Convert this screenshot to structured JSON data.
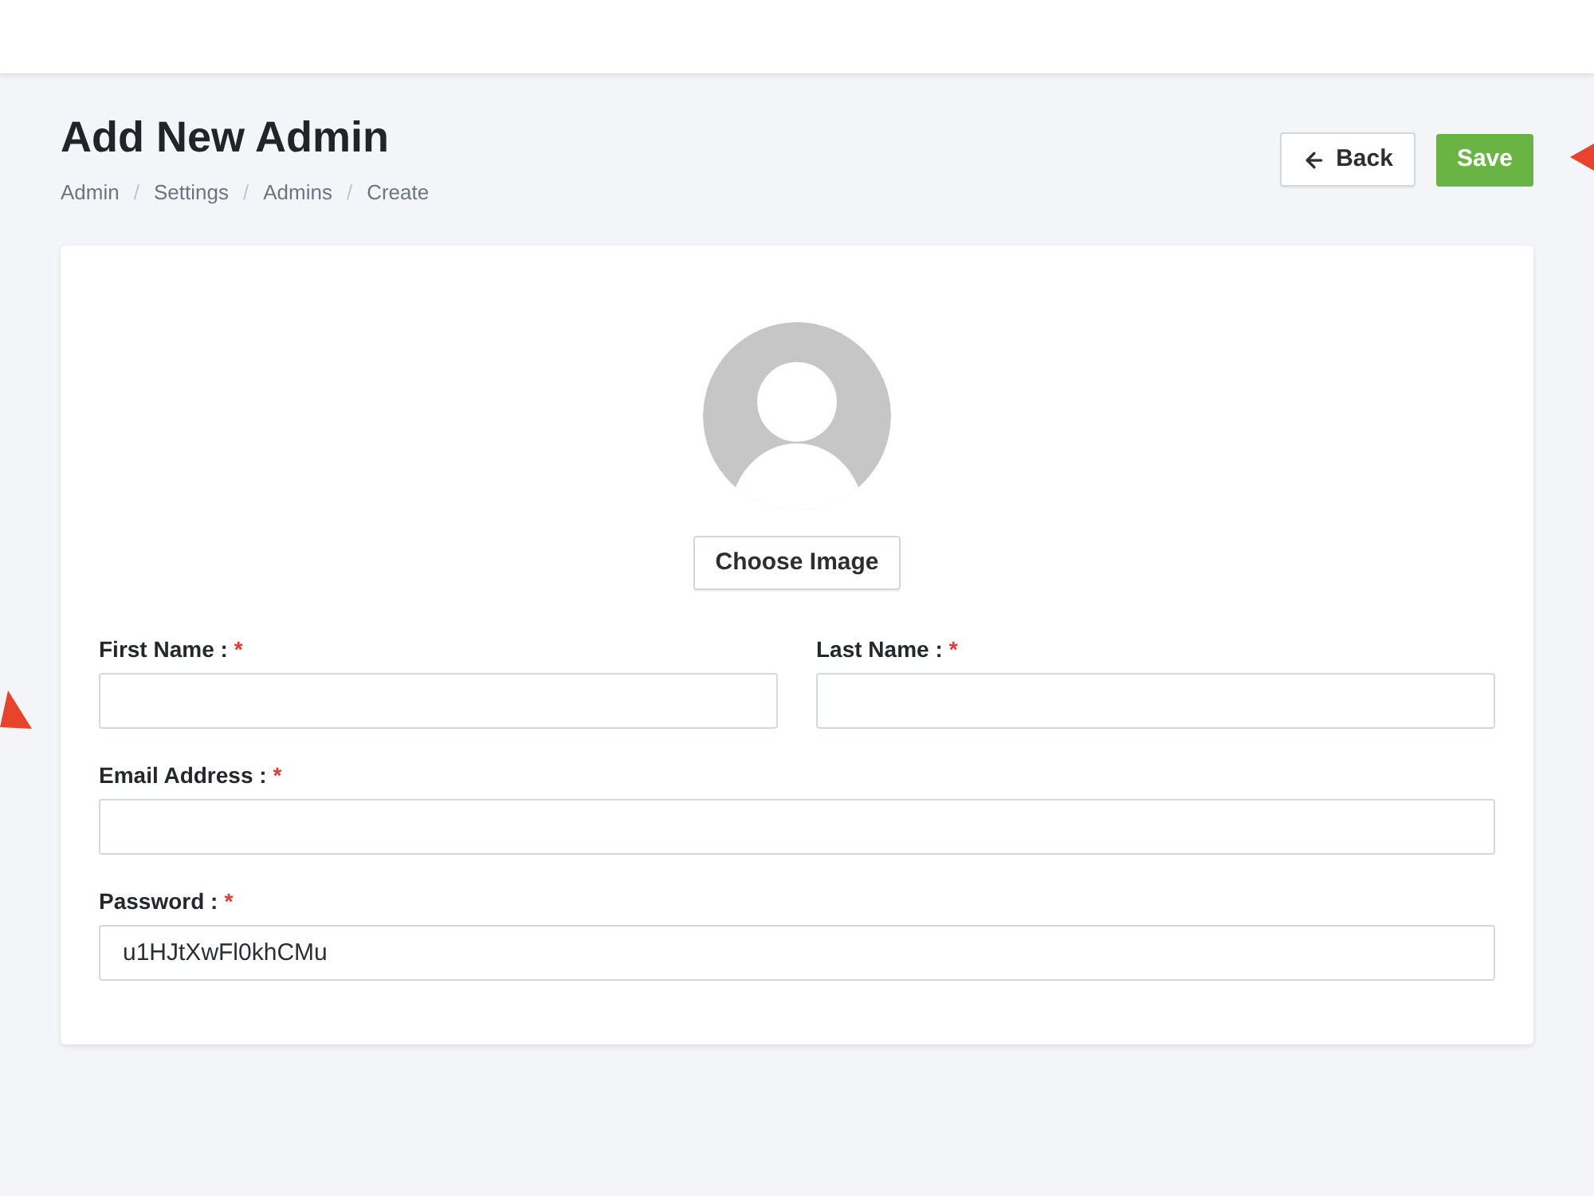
{
  "header": {
    "title": "Add New Admin",
    "breadcrumb": [
      {
        "kind": "link",
        "text": "Admin"
      },
      {
        "kind": "separator",
        "text": "/"
      },
      {
        "kind": "link",
        "text": "Settings"
      },
      {
        "kind": "separator",
        "text": "/"
      },
      {
        "kind": "link",
        "text": "Admins"
      },
      {
        "kind": "separator",
        "text": "/"
      },
      {
        "kind": "current",
        "text": "Create"
      }
    ],
    "actions": [
      {
        "kind": "back",
        "label": "Back"
      },
      {
        "kind": "primary",
        "label": "Save"
      }
    ]
  },
  "form": {
    "choose_image_button": "Choose Image",
    "rows": [
      [
        {
          "label": "First Name :",
          "required_mark": "*"
        },
        {
          "label": "Last Name :",
          "required_mark": "*"
        }
      ],
      [
        {
          "label": "Email Address :",
          "required_mark": "*"
        }
      ],
      [
        {
          "label": "Password :",
          "required_mark": "*",
          "value": "u1HJtXwFl0khCMu"
        }
      ]
    ]
  }
}
